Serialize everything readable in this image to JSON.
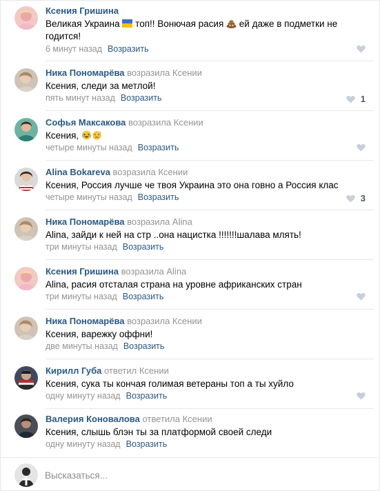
{
  "comments": [
    {
      "author": "Ксения Гришина",
      "reply_prefix": "",
      "reply_to": "",
      "text_1": "Великая Украина ",
      "text_2": " топ!! Вонючая расия ",
      "text_3": " ей даже в подметки не годится!",
      "time": "6 минут назад",
      "reply_label": "Возразить",
      "likes": ""
    },
    {
      "author": "Ника Пономарёва",
      "reply_prefix": " возразила",
      "reply_to": " Ксении",
      "text": "Ксения, следи за метлой!",
      "time": "пять минут назад",
      "reply_label": "Возразить",
      "likes": "1"
    },
    {
      "author": "Софья Максакова",
      "reply_prefix": " возразила",
      "reply_to": " Ксении",
      "text": "Ксения, ",
      "time": "четыре минуты назад",
      "reply_label": "Возразить",
      "likes": ""
    },
    {
      "author": "Alina Bokareva",
      "reply_prefix": " возразила",
      "reply_to": " Ксении",
      "text": "Ксения, Россия лучше че твоя Украина это она говно а Россия клас",
      "time": "четыре минуты назад",
      "reply_label": "Возразить",
      "likes": "3"
    },
    {
      "author": "Ника Пономарёва",
      "reply_prefix": " возразила",
      "reply_to": " Alina",
      "text": "Alina, зайди к ней на стр ..она нацистка !!!!!!!шалава млять!",
      "time": "три минуты назад",
      "reply_label": "Возразить",
      "likes": ""
    },
    {
      "author": "Ксения Гришина",
      "reply_prefix": " возразила",
      "reply_to": " Alina",
      "text": "Alina, расия отсталая страна на уровне африканских стран",
      "time": "три минуты назад",
      "reply_label": "Возразить",
      "likes": ""
    },
    {
      "author": "Ника Пономарёва",
      "reply_prefix": " возразила",
      "reply_to": " Ксении",
      "text": "Ксения, варежку оффни!",
      "time": "две минуты назад",
      "reply_label": "Возразить",
      "likes": ""
    },
    {
      "author": "Кирилл Губа",
      "reply_prefix": " ответил",
      "reply_to": " Ксении",
      "text": "Ксения, сука ты кончая голимая ветераны топ а ты хуйло",
      "time": "одну минуту назад",
      "reply_label": "Возразить",
      "likes": ""
    },
    {
      "author": "Валерия Коновалова",
      "reply_prefix": " ответила",
      "reply_to": " Ксении",
      "text": "Ксения, слышь блэн ты за платформой своей следи",
      "time": "одну минуту назад",
      "reply_label": "Возразить",
      "likes": ""
    }
  ],
  "composer": {
    "placeholder": "Высказаться..."
  },
  "icons": {
    "like": "heart-icon",
    "flag": "ukraine-flag-icon",
    "poop": "poop-emoji-icon",
    "laugh": "laughing-emoji-icon",
    "sweat": "sweat-emoji-icon"
  },
  "colors": {
    "link": "#2a5885",
    "muted": "#939393",
    "separator": "#e7e8ec"
  }
}
